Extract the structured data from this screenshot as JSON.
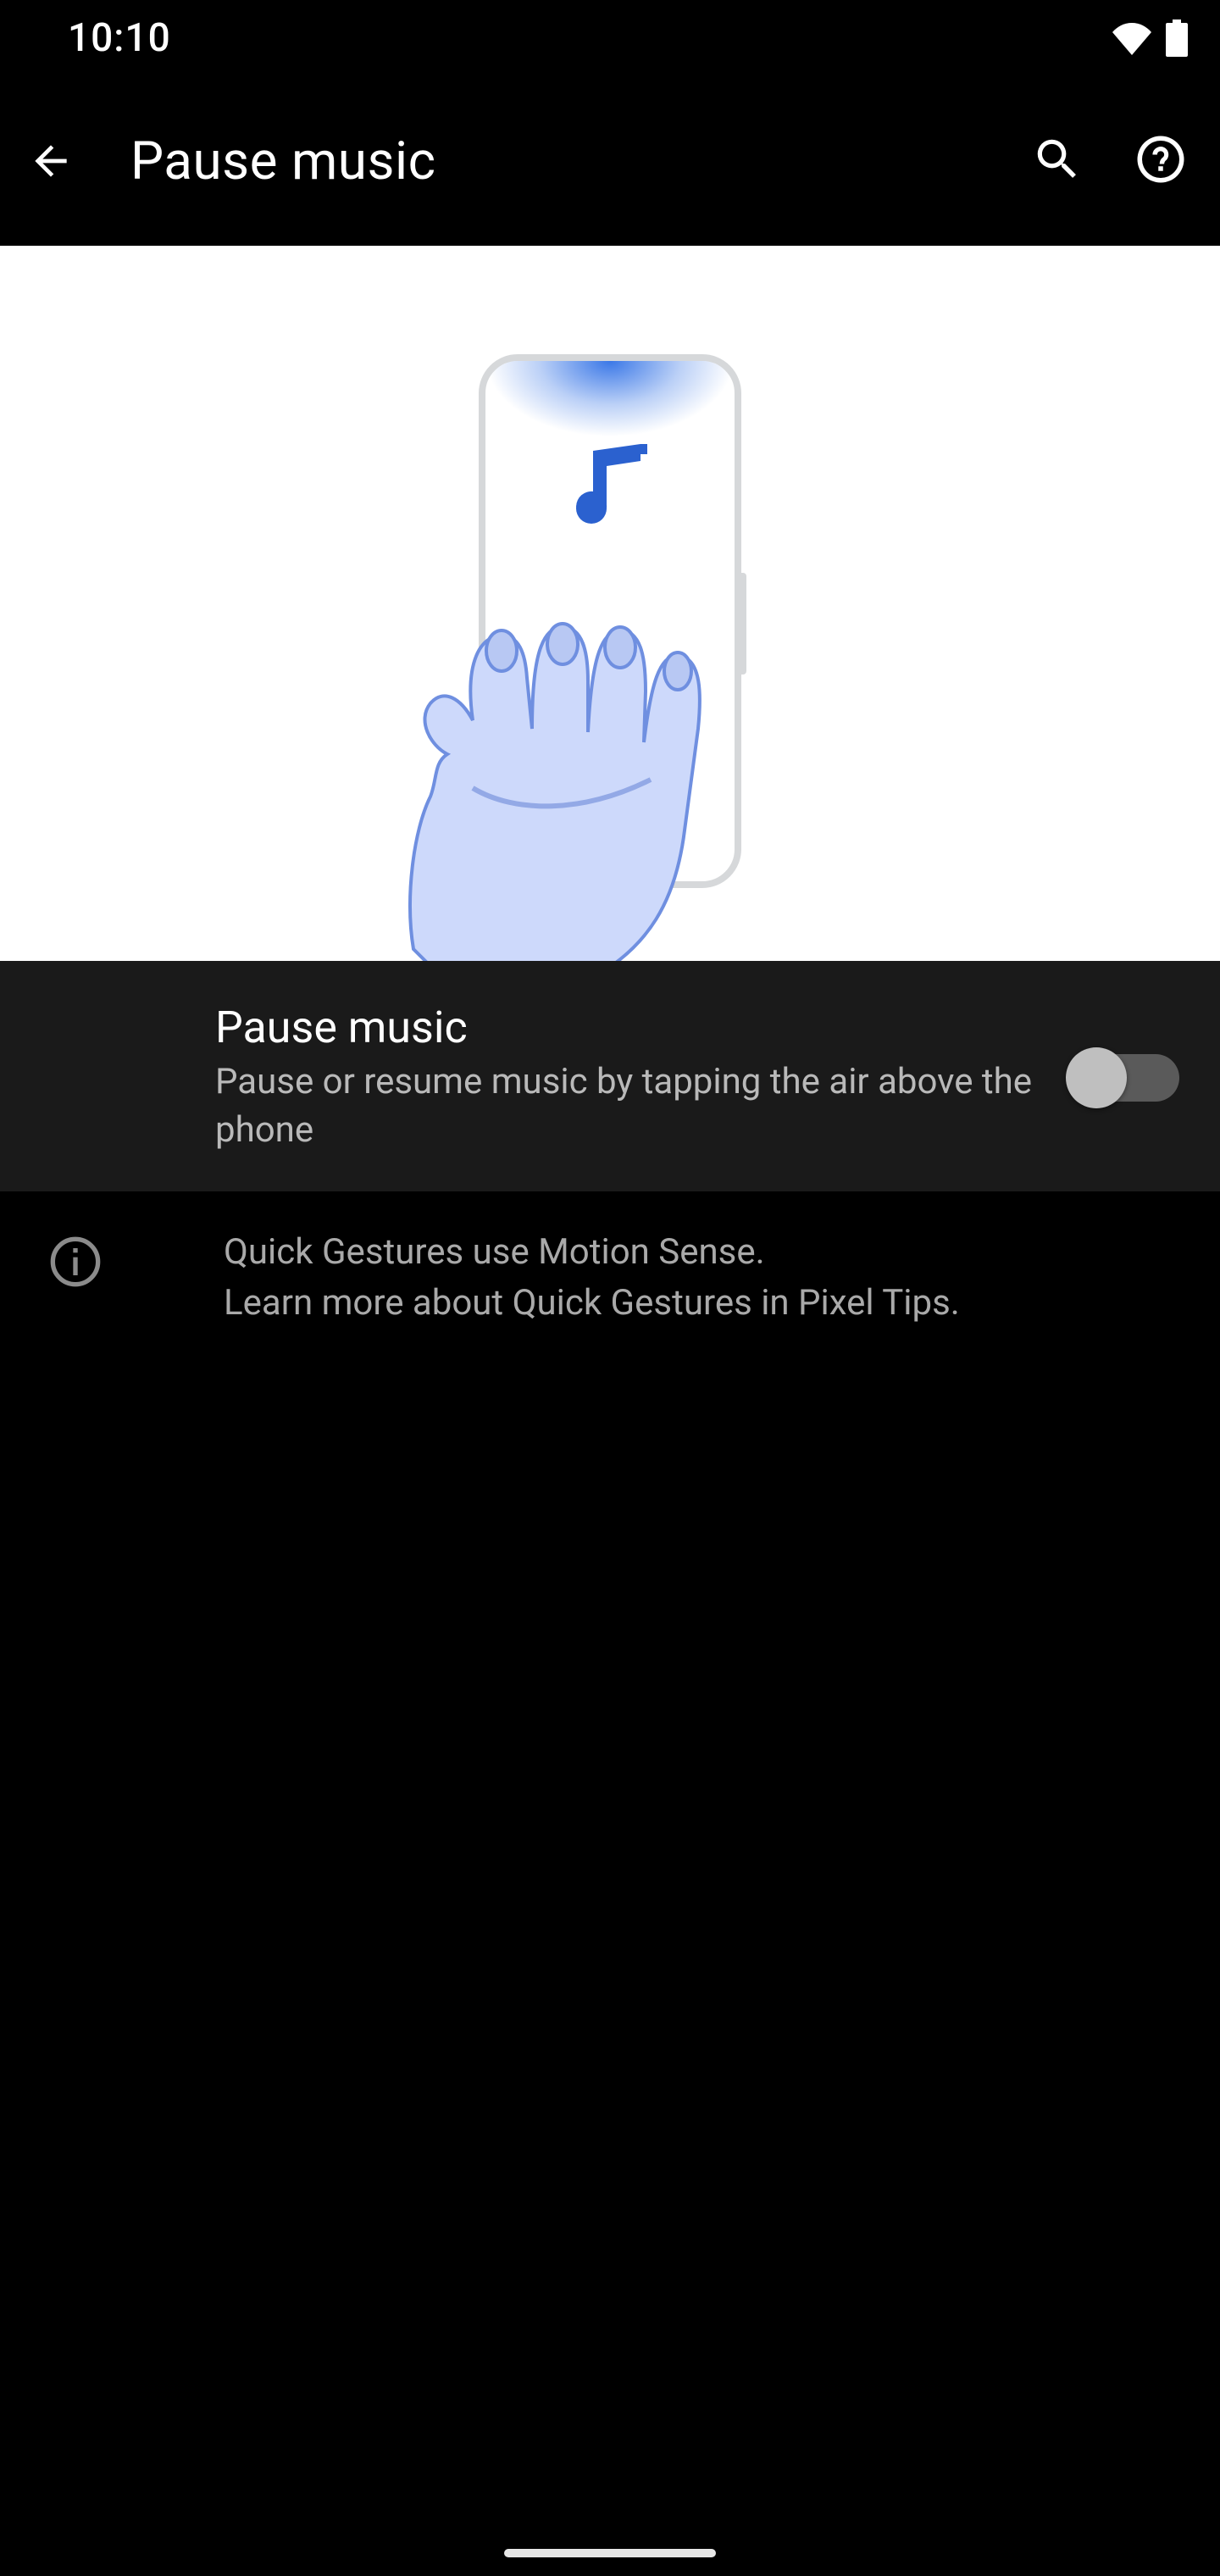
{
  "status": {
    "time": "10:10"
  },
  "appbar": {
    "title": "Pause music"
  },
  "setting": {
    "title": "Pause music",
    "subtitle": "Pause or resume music by tapping the air above the phone",
    "enabled": false
  },
  "info": {
    "line1": "Quick Gestures use Motion Sense.",
    "line2": "Learn more about Quick Gestures in Pixel Tips."
  }
}
